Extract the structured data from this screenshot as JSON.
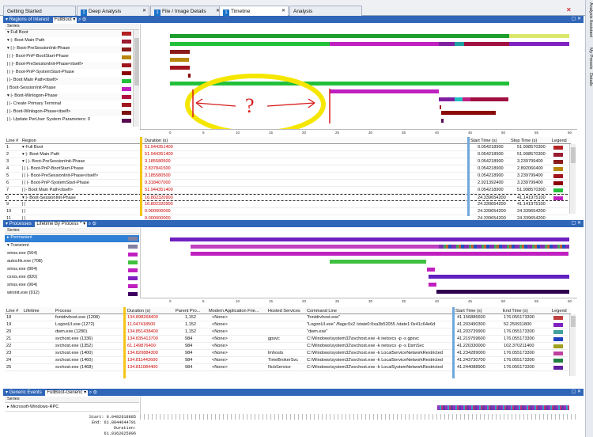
{
  "tabs": [
    {
      "label": "Getting Started",
      "num": ""
    },
    {
      "label": "Deep Analysis",
      "num": "1"
    },
    {
      "label": "File / Image Details",
      "num": "1"
    },
    {
      "label": "Timeline",
      "num": "1"
    },
    {
      "label": "Analysis",
      "num": ""
    }
  ],
  "side_tabs": [
    "Analysis Assistant",
    "My Presets",
    "Details"
  ],
  "roi": {
    "title": "Regions of Interest",
    "preset": "FullBoot",
    "series_label": "Series",
    "rows": [
      {
        "label": "▾ Full Boot",
        "color": "#b22222"
      },
      {
        "label": "▾ |- Boot Main Path",
        "color": "#9b1b30"
      },
      {
        "label": "▾ |  |- Boot-PreSessionInit-Phase",
        "color": "#8b1a1a"
      },
      {
        "label": "|  |  |- Boot-PnP-BootStart-Phase",
        "color": "#b8860b"
      },
      {
        "label": "|  |  |- Boot-PreSessionInit-Phase<itself>",
        "color": "#a0141e"
      },
      {
        "label": "|  |  |- Boot-PnP-SystemStart-Phase",
        "color": "#8b0000"
      },
      {
        "label": "|  |- Boot Main Path<itself>",
        "color": "#22c03a"
      },
      {
        "label": "|  Boot-SessionInit-Phase",
        "color": "#c020c0"
      },
      {
        "label": "▾ |- Boot-Winlogon-Phase",
        "color": "#b01040"
      },
      {
        "label": "|  |- Create Primary Terminal",
        "color": "#a0141e"
      },
      {
        "label": "|  |- Boot-Winlogon-Phase<itself>",
        "color": "#7a1010"
      },
      {
        "label": "|  |- Update PerUser System Parameters: 0",
        "color": "#5a0a50"
      }
    ],
    "ticks": [
      "0",
      "5",
      "10",
      "15",
      "20",
      "25",
      "30",
      "35",
      "40",
      "45",
      "50",
      "55",
      "60"
    ],
    "annotation": "?",
    "table": {
      "headers": [
        "Line #",
        "Region",
        "Duration (s)",
        "Start Time (s)",
        "Stop Time (s)",
        "Legend"
      ],
      "rows": [
        {
          "line": "1",
          "region": "▾ Full Boot",
          "dur": "51.944351400",
          "start": "0.054218900",
          "stop": "51.998570300",
          "color": "#b22222"
        },
        {
          "line": "2",
          "region": "▾ |- Boot Main Path",
          "dur": "51.944351400",
          "start": "0.054218900",
          "stop": "51.998570300",
          "color": "#9b1b30"
        },
        {
          "line": "3",
          "region": "▾ |  |- Boot-PreSessionInit-Phase",
          "dur": "3.185580500",
          "start": "0.054218900",
          "stop": "3.239799400",
          "color": "#8b1a1a"
        },
        {
          "line": "4",
          "region": "|  |  |- Boot-PnP-BootStart-Phase",
          "dur": "2.837841500",
          "start": "0.054218900",
          "stop": "2.892060400",
          "color": "#b8860b"
        },
        {
          "line": "5",
          "region": "|  |  |- Boot-PreSessionInit-Phase<itself>",
          "dur": "3.185580500",
          "start": "0.054218900",
          "stop": "3.239799400",
          "color": "#a0141e"
        },
        {
          "line": "6",
          "region": "|  |  |- Boot-PnP-SystemStart-Phase",
          "dur": "0.318407000",
          "start": "2.921392400",
          "stop": "3.239799400",
          "color": "#8b0000"
        },
        {
          "line": "7",
          "region": "|  |- Boot Main Path<itself>",
          "dur": "51.944351400",
          "start": "0.054218900",
          "stop": "51.998570300",
          "color": "#22c03a"
        },
        {
          "line": "8",
          "region": "▾ |- Boot-SessionInit-Phase",
          "dur": "16.802320900",
          "start": "24.339654200",
          "stop": "41.141975100",
          "color": "#c020c0"
        },
        {
          "line": "9",
          "region": "|  |",
          "dur": "16.802320900",
          "start": "24.339654200",
          "stop": "41.141975100",
          "color": ""
        },
        {
          "line": "10",
          "region": "|  |",
          "dur": "0.000000000",
          "start": "24.339654200",
          "stop": "24.339654200",
          "color": ""
        },
        {
          "line": "11",
          "region": "|  |",
          "dur": "0.000000000",
          "start": "24.339654200",
          "stop": "24.339654200",
          "color": ""
        }
      ]
    }
  },
  "proc": {
    "title": "Processes",
    "preset": "Lifetime By Process *",
    "series_label": "Series",
    "rows": [
      {
        "label": "▸ Permanent",
        "color": "#8080a0",
        "selected": true
      },
      {
        "label": "▾ Transient",
        "color": "#8080a0",
        "selected": false
      },
      {
        "label": "smss.exe (564)",
        "color": "#c020c0",
        "selected": false
      },
      {
        "label": "autochk.exe (708)",
        "color": "#40c040",
        "selected": false
      },
      {
        "label": "smss.exe (804)",
        "color": "#c020c0",
        "selected": false
      },
      {
        "label": "csrss.exe (820)",
        "color": "#8020c0",
        "selected": false
      },
      {
        "label": "smss.exe (904)",
        "color": "#c020c0",
        "selected": false
      },
      {
        "label": "wininit.exe (912)",
        "color": "#400060",
        "selected": false
      }
    ],
    "ticks": [
      "0",
      "5",
      "10",
      "15",
      "20",
      "25",
      "30",
      "35",
      "40",
      "45",
      "50",
      "55",
      "60"
    ],
    "table": {
      "headers": [
        "Line #",
        "Lifetime",
        "Process",
        "Duration (s)",
        "Parent Pro...",
        "Modern Application Frie...",
        "Hosted Services",
        "Command Line",
        "Start Time (s)",
        "End Time (s)",
        "Legend"
      ],
      "rows": [
        {
          "line": "18",
          "process": "fontdrvhost.exe (1208)",
          "dur": "134.898268400",
          "parent": "1,152",
          "modern": "<None>",
          "hosted": "",
          "cmd": "\"fontdrvhost.exe\"",
          "start": "41.156886600",
          "end": "176.055173300",
          "color": "#c04040"
        },
        {
          "line": "19",
          "process": "LogonUI.exe (1272)",
          "dur": "11.047418500",
          "parent": "1,152",
          "modern": "<None>",
          "hosted": "",
          "cmd": "\"LogonUI.exe\" /flags:0x2 /state0:0xa3b52055 /state1:0x41c64e6d",
          "start": "41.203490300",
          "end": "52.250911800",
          "color": "#8020c0"
        },
        {
          "line": "20",
          "process": "dwm.exe (1280)",
          "dur": "134.851438400",
          "parent": "1,152",
          "modern": "<None>",
          "hosted": "",
          "cmd": "\"dwm.exe\"",
          "start": "41.203739900",
          "end": "176.055173300",
          "color": "#40a0a0"
        },
        {
          "line": "21",
          "process": "svchost.exe (1336)",
          "dur": "134.835413700",
          "parent": "984",
          "modern": "<None>",
          "hosted": "gpsvc",
          "cmd": "C:\\Windows\\system32\\svchost.exe -k netsvcs -p -s gpsvc",
          "start": "41.219759600",
          "end": "176.055173300",
          "color": "#2040c0"
        },
        {
          "line": "22",
          "process": "svchost.exe (1352)",
          "dur": "61.149876400",
          "parent": "984",
          "modern": "<None>",
          "hosted": "",
          "cmd": "C:\\Windows\\system32\\svchost.exe -k netsvcs -p -s DsmSvc",
          "start": "41.220330000",
          "end": "102.370211400",
          "color": "#a0a020"
        },
        {
          "line": "23",
          "process": "svchost.exe (1400)",
          "dur": "134.820884300",
          "parent": "984",
          "modern": "<None>",
          "hosted": "lmhosts",
          "cmd": "C:\\Windows\\system32\\svchost.exe -k LocalServiceNetworkRestricted",
          "start": "41.234289000",
          "end": "176.055173300",
          "color": "#c040a0"
        },
        {
          "line": "24",
          "process": "svchost.exe (1460)",
          "dur": "134.811442600",
          "parent": "984",
          "modern": "<None>",
          "hosted": "TimeBrokerSvc",
          "cmd": "C:\\Windows\\system32\\svchost.exe -k LocalServiceNetworkRestricted",
          "start": "41.243730700",
          "end": "176.055173300",
          "color": "#208040"
        },
        {
          "line": "25",
          "process": "svchost.exe (1468)",
          "dur": "134.811084400",
          "parent": "984",
          "modern": "<None>",
          "hosted": "NcbService",
          "cmd": "C:\\Windows\\system32\\svchost.exe -k LocalSystemNetworkRestricted",
          "start": "41.244088900",
          "end": "176.055173300",
          "color": "#6020a0"
        }
      ]
    }
  },
  "generic": {
    "title": "Generic Events",
    "preset": "FullBoot-Generic",
    "series_row": "▸ Microsoft-Windows-RPC",
    "footer": {
      "start": "Start:   0.0482618885",
      "end": "End:  61.8844644791",
      "duration": "Duration:  61.8362025906"
    }
  }
}
